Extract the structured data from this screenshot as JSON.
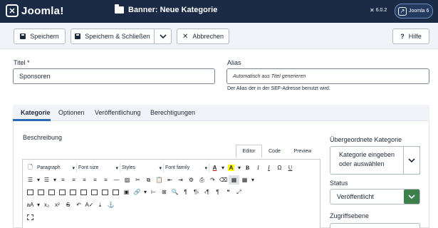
{
  "header": {
    "logo_text": "Joomla!",
    "logo_mark": "✕",
    "title": "Banner: Neue Kategorie",
    "version": "6.0.2",
    "version_icon": "joomla-icon",
    "user_label": "Joomla 6",
    "user_icon": "external-link-icon"
  },
  "toolbar": {
    "save": "Speichern",
    "save_close": "Speichern & Schließen",
    "dropdown_icon": "chevron-down-icon",
    "cancel": "Abbrechen",
    "help": "Hilfe"
  },
  "form": {
    "title_label": "Titel *",
    "title_value": "Sponsoren",
    "alias_label": "Alias",
    "alias_placeholder": "Automatisch aus Titel generieren",
    "alias_help": "Der Alias der in der SEF-Adresse benutzt wird."
  },
  "tabs": [
    "Kategorie",
    "Optionen",
    "Veröffentlichung",
    "Berechtigungen"
  ],
  "editor": {
    "section_label": "Beschreibung",
    "modes": [
      "Editor",
      "Code",
      "Preview"
    ],
    "paragraph": "Paragraph",
    "font_size": "Font size",
    "styles": "Styles",
    "font_family": "Font family"
  },
  "sidebar": {
    "parent_label": "Übergeordnete Kategorie",
    "parent_placeholder_1": "Kategorie eingeben",
    "parent_placeholder_2": "oder auswählen",
    "status_label": "Status",
    "status_value": "Veröffentlicht",
    "access_label": "Zugriffsebene"
  },
  "colors": {
    "header_bg": "#1b2b45",
    "accent_blue": "#2a69b8",
    "status_green": "#3d7f4d"
  }
}
